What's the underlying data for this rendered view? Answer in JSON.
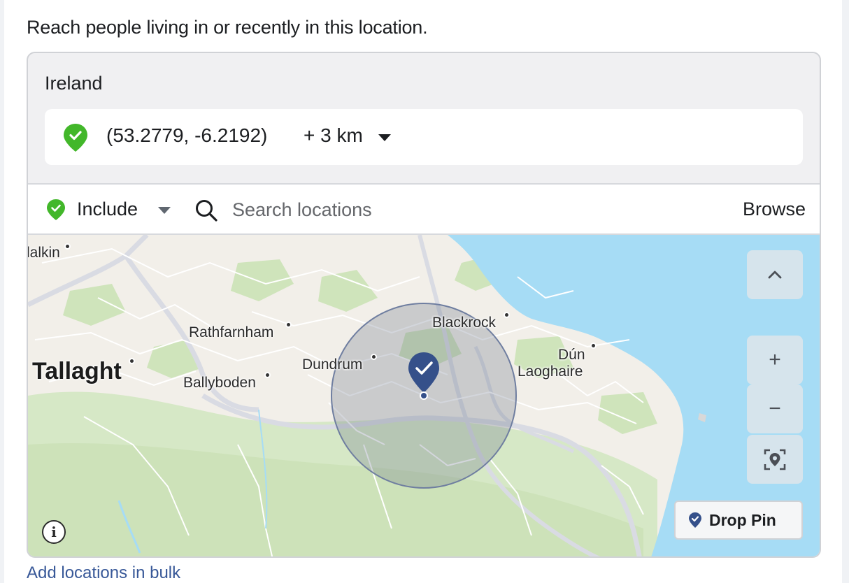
{
  "intro_text": "Reach people living in or recently in this location.",
  "country": "Ireland",
  "selected_location": {
    "coordinates": "(53.2779, -6.2192)",
    "radius": "+ 3 km",
    "status_icon": "check-pin-icon",
    "status_color": "#42b72a"
  },
  "toolbar": {
    "mode_label": "Include",
    "search_placeholder": "Search locations",
    "browse_label": "Browse"
  },
  "map": {
    "places": [
      {
        "name": "lalkin"
      },
      {
        "name": "Rathfarnham"
      },
      {
        "name": "Blackrock"
      },
      {
        "name": "Tallaght"
      },
      {
        "name": "Dundrum"
      },
      {
        "name": "Dún"
      },
      {
        "name": "Laoghaire"
      },
      {
        "name": "Ballyboden"
      }
    ],
    "zoom_in": "+",
    "zoom_out": "−",
    "drop_pin_label": "Drop Pin",
    "info_label": "i",
    "accent_color": "#4267b2",
    "water_color": "#a6dcf5",
    "park_color": "#cde5b8"
  },
  "bulk_link": "Add locations in bulk"
}
